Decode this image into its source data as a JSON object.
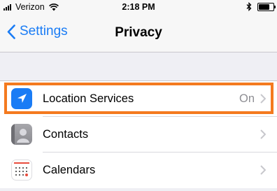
{
  "status_bar": {
    "carrier": "Verizon",
    "time": "2:18 PM",
    "battery_level": 0.85
  },
  "nav": {
    "back_label": "Settings",
    "title": "Privacy"
  },
  "rows": [
    {
      "label": "Location Services",
      "value": "On",
      "icon": "location-arrow-icon"
    },
    {
      "label": "Contacts",
      "value": "",
      "icon": "contacts-icon"
    },
    {
      "label": "Calendars",
      "value": "",
      "icon": "calendar-icon"
    }
  ],
  "colors": {
    "accent": "#1a7cf5",
    "highlight": "#f47a1f",
    "background": "#efeff4"
  }
}
